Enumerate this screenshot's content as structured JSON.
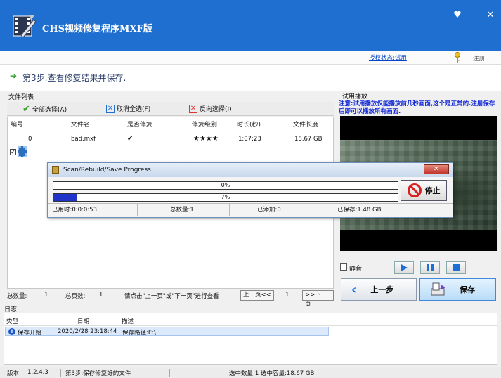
{
  "window": {
    "title": "CHS视频修复程序MXF版",
    "controls": [
      "♥",
      "—",
      "✕"
    ]
  },
  "topbar": {
    "auth_status": "授权状态:试用",
    "register": "注册"
  },
  "step": {
    "title": "第3步.查看修复结果并保存."
  },
  "file_list": {
    "label": "文件列表",
    "toolbar": {
      "select_all": "全部选择(A)",
      "deselect_all": "取消全选(F)",
      "invert": "反向选择(I)"
    },
    "columns": [
      "编号",
      "文件名",
      "是否修复",
      "修复级别",
      "时长(秒)",
      "文件长度"
    ],
    "rows": [
      {
        "index": "0",
        "filename": "bad.mxf",
        "repaired": "✔",
        "level": "★★★★",
        "duration": "1:07:23",
        "size": "18.67 GB"
      }
    ]
  },
  "pager": {
    "total_label": "总数量:",
    "total": "1",
    "pages_label": "总页数:",
    "pages": "1",
    "hint": "请点击\"上一页\"或\"下一页\"进行查看",
    "prev": "上一页<<",
    "current": "1",
    "next": ">>下一页"
  },
  "preview": {
    "label": "试用播放",
    "note": "注意:试用播放仅能播放前几秒画面,这个是正常的.注册保存后即可以播放所有画面.",
    "mute": "静音"
  },
  "actions": {
    "prev_step": "上一步",
    "save": "保存"
  },
  "dialog": {
    "title": "Scan/Rebuild/Save Progress",
    "close": "✕",
    "progress1_text": "0%",
    "progress1": 0,
    "progress2_text": "7%",
    "progress2": 0.07,
    "stop": "停止",
    "elapsed": "已用时:0:0:0:53",
    "total": "总数量:1",
    "added": "已添加:0",
    "saved": "已保存:1.48 GB"
  },
  "log": {
    "label": "日志",
    "columns": [
      "类型",
      "日期",
      "描述"
    ],
    "rows": [
      {
        "type": "保存开始",
        "date": "2020/2/28 23:18:44",
        "desc": "保存路径:E:\\"
      }
    ]
  },
  "statusbar": {
    "version_label": "版本:",
    "version": "1.2.4.3",
    "step_text": "第3步:保存修复好的文件",
    "selection": "选中数量:1 选中容量:18.67 GB"
  },
  "colors": {
    "titlebar": "#1f6fd1",
    "progress": "#1f33c8",
    "note": "#1228d6"
  }
}
